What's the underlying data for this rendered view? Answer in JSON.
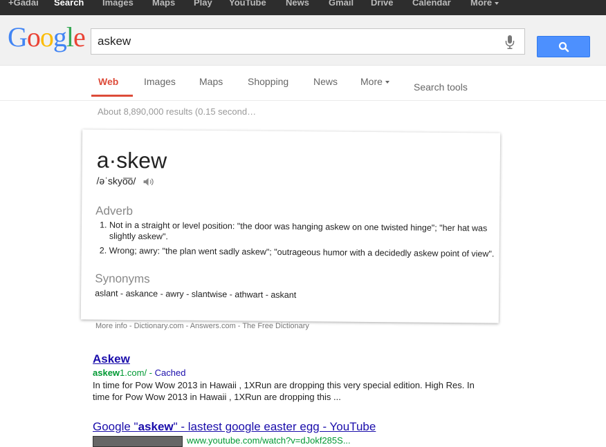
{
  "topbar": {
    "items": [
      "+Gadai",
      "Search",
      "Images",
      "Maps",
      "Play",
      "YouTube",
      "News",
      "Gmail",
      "Drive",
      "Calendar",
      "More"
    ],
    "active_index": 1
  },
  "logo": {
    "letters": [
      "G",
      "o",
      "o",
      "g",
      "l",
      "e"
    ],
    "colors": [
      "#4285f4",
      "#ea4335",
      "#fbbc05",
      "#4285f4",
      "#34a853",
      "#ea4335"
    ]
  },
  "search": {
    "query": "askew"
  },
  "tabs": {
    "items": [
      "Web",
      "Images",
      "Maps",
      "Shopping",
      "News",
      "More",
      "Search tools"
    ],
    "active_index": 0
  },
  "stats": "About 8,890,000 results (0.15 second…",
  "definition": {
    "word": "a·skew",
    "phonetic": "/əˈskyo͞o/",
    "part_of_speech": "Adverb",
    "definitions": [
      "Not in a straight or level position: \"the door was hanging askew on one twisted hinge\"; \"her hat was slightly askew\".",
      "Wrong; awry: \"the plan went sadly askew\"; \"outrageous humor with a decidedly askew point of view\"."
    ],
    "synonyms_label": "Synonyms",
    "synonyms": "aslant - askance - awry - slantwise - athwart - askant"
  },
  "more_info": "More info - Dictionary.com - Answers.com - The Free Dictionary",
  "results": [
    {
      "title": "Askew",
      "url_bold": "askew",
      "url_rest": "1.com/",
      "cached": "Cached",
      "snippet": "In time for Pow Wow 2013 in Hawaii , 1XRun are dropping this very special edition. High Res. In time for Pow Wow 2013 in Hawaii , 1XRun are dropping this ..."
    },
    {
      "title_pre": "Google \"",
      "title_bold": "askew",
      "title_post": "\" - lastest google easter egg - YouTube",
      "url": "www.youtube.com/watch?v=dJokf285S..."
    }
  ],
  "colors": {
    "accent_red": "#dd4b39",
    "link_blue": "#1a0dab",
    "url_green": "#009933",
    "search_button": "#4d90fe"
  }
}
